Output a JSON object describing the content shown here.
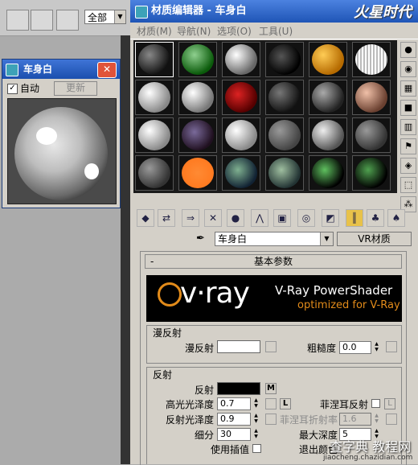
{
  "background_app": {
    "dropdown_value": "全部",
    "small_window": {
      "title": "车身白",
      "close_label": "✕",
      "auto_checkbox": "✓",
      "auto_label": "自动",
      "update_button": "更新"
    }
  },
  "material_editor": {
    "title": "材质编辑器 - 车身白",
    "watermark": "火星时代",
    "watermark_url": "www.hxsd.com",
    "menu": [
      "材质(M)",
      "导航(N)",
      "选项(O)",
      "工具(U)"
    ],
    "material_name": "车身白",
    "material_type_button": "VR材质",
    "rollout_title": "基本参数",
    "rollout_toggle": "-",
    "vray_banner": {
      "logo_text": "v·ray",
      "product": "V-Ray PowerShader",
      "tagline": "optimized for V-Ray"
    },
    "diffuse_group": {
      "title": "漫反射",
      "diffuse_label": "漫反射",
      "roughness_label": "粗糙度",
      "roughness_value": "0.0"
    },
    "reflection_group": {
      "title": "反射",
      "reflect_label": "反射",
      "reflect_map_button": "M",
      "hilight_gloss_label": "高光光泽度",
      "hilight_gloss_value": "0.7",
      "hilight_lock_button": "L",
      "fresnel_label": "菲涅耳反射",
      "fresnel_lock_button": "L",
      "refl_gloss_label": "反射光泽度",
      "refl_gloss_value": "0.9",
      "fresnel_ior_label": "菲涅耳折射率",
      "fresnel_ior_value": "1.6",
      "subdivs_label": "细分",
      "subdivs_value": "30",
      "max_depth_label": "最大深度",
      "max_depth_value": "5",
      "use_interp_label": "使用插值",
      "exit_color_label": "退出颜色"
    }
  },
  "bottom_watermark": {
    "text": "查字典 教程网",
    "url": "jiaocheng.chazidian.com"
  },
  "colors": {
    "title_bar": "#1f55b6",
    "diffuse_swatch": "#ffffff",
    "reflect_swatch": "#000000",
    "vray_orange": "#e28b1a"
  }
}
